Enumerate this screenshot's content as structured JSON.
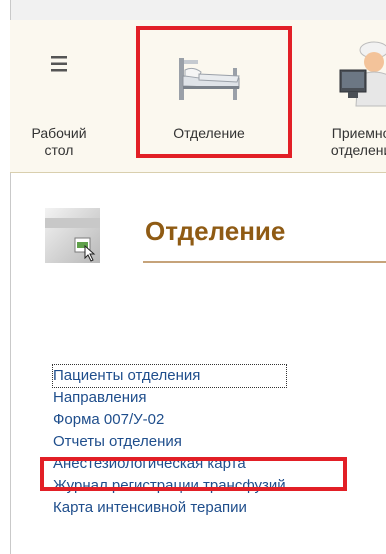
{
  "sections": [
    {
      "label": "Рабочий\nстол",
      "icon": "hamburger-menu-icon"
    },
    {
      "label": "Отделение",
      "icon": "hospital-bed-icon"
    },
    {
      "label": "Приемное\nотделение",
      "icon": "doctor-at-computer-icon"
    }
  ],
  "form": {
    "title": "Отделение",
    "icon": "form-window-icon"
  },
  "links": [
    "Пациенты отделения",
    "Направления",
    "Форма 007/У-02",
    "Отчеты отделения",
    "Анестезиологическая карта",
    "Журнал регистрации трансфузий",
    "Карта интенсивной терапии"
  ],
  "colors": {
    "highlight": "#e21f26",
    "title": "#8f5b14",
    "link": "#1f4e8c"
  }
}
